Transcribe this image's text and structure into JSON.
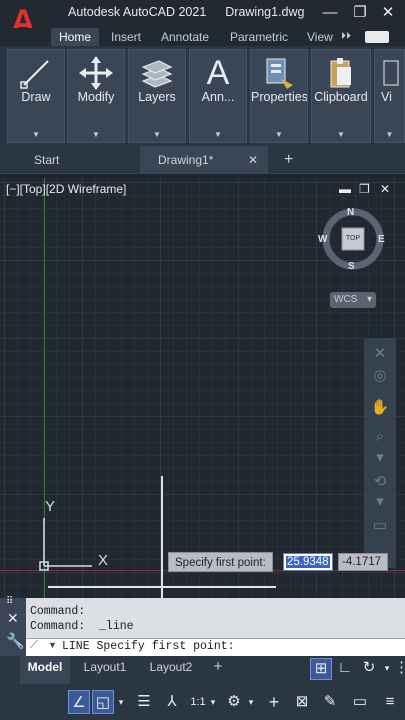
{
  "app": {
    "title": "Autodesk AutoCAD 2021",
    "document": "Drawing1.dwg",
    "logo_letter": "A"
  },
  "window_controls": {
    "minimize": "—",
    "maximize": "❐",
    "close": "✕"
  },
  "ribbon_tabs": {
    "home": "Home",
    "insert": "Insert",
    "annotate": "Annotate",
    "parametric": "Parametric",
    "view": "View",
    "more": "⏵⏵"
  },
  "ribbon_panels": {
    "draw": "Draw",
    "modify": "Modify",
    "layers": "Layers",
    "annotation": "Ann...",
    "properties": "Properties",
    "clipboard": "Clipboard",
    "view": "Vi"
  },
  "file_tabs": {
    "start": "Start",
    "drawing": "Drawing1*",
    "close": "✕",
    "new": "+"
  },
  "viewport": {
    "label": "[−][Top][2D Wireframe]",
    "minimize": "▬",
    "restore": "❐",
    "close": "✕"
  },
  "viewcube": {
    "north": "N",
    "south": "S",
    "west": "W",
    "east": "E",
    "face": "TOP",
    "wcs": "WCS"
  },
  "ucs": {
    "y": "Y",
    "x": "X"
  },
  "dynamic_input": {
    "prompt": "Specify first point:",
    "x_value": "25.9348",
    "y_value": "-4.1717"
  },
  "command": {
    "history_1": "Command:",
    "history_2": "Command:  _line",
    "current": "LINE Specify first point:"
  },
  "layout_tabs": {
    "model": "Model",
    "layout1": "Layout1",
    "layout2": "Layout2",
    "add": "+"
  },
  "status": {
    "annotation_scale": "1:1"
  },
  "colors": {
    "logo_red": "#e0312b",
    "ribbon_panel": "#3a4656",
    "y_axis_green": "#2f7a2f",
    "x_axis_red": "#8a2a2a",
    "highlight_blue": "#3a64c8"
  }
}
